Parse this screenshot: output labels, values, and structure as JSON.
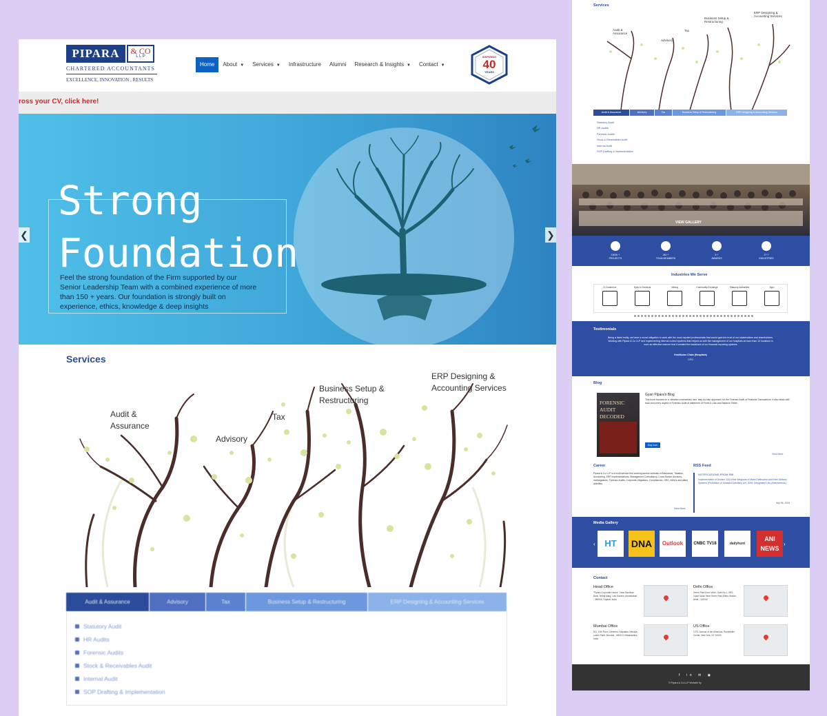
{
  "logo": {
    "name": "PIPARA",
    "co": "& CO",
    "llp": "L L P",
    "subtitle": "CHARTERED ACCOUNTANTS",
    "tagline": "EXCELLENCE, INNOVATION , RESULTS"
  },
  "nav": {
    "items": [
      {
        "label": "Home",
        "active": true,
        "dropdown": false
      },
      {
        "label": "About",
        "dropdown": true
      },
      {
        "label": "Services",
        "dropdown": true
      },
      {
        "label": "Infrastructure",
        "dropdown": false
      },
      {
        "label": "Alumni",
        "dropdown": false
      },
      {
        "label": "Research & Insights",
        "dropdown": true
      },
      {
        "label": "Contact",
        "dropdown": true
      }
    ]
  },
  "badge": {
    "top": "INSPIRING",
    "number": "40",
    "bottom": "YEARS"
  },
  "ticker": {
    "text": "ross your CV, click here!"
  },
  "hero": {
    "title": "Strong\nFoundation",
    "text": "Feel the strong foundation of the Firm supported by our Senior Leadership Team with a combined experience of more than 150 + years. Our foundation is strongly built on experience, ethics, knowledge & deep insights"
  },
  "services": {
    "heading": "Services",
    "tree_labels": [
      "Audit &\nAssurance",
      "Advisory",
      "Tax",
      "Business Setup &\nRestructuring",
      "ERP Designing &\nAccounting Services"
    ],
    "tabs": [
      "Audit & Assurance",
      "Advisory",
      "Tax",
      "Business Setup & Restructuring",
      "ERP Designing & Accounting Services"
    ],
    "list": [
      "Statutory Audit",
      "HR Audits",
      "Forensic Audits",
      "Stock & Receivables Audit",
      "Internal Audit",
      "SOP Drafting & Implementation"
    ]
  },
  "right": {
    "services_heading": "Services",
    "gallery_label": "VIEW GALLERY",
    "stats": [
      {
        "value": "15000 +",
        "label": "PROJECTS"
      },
      {
        "value": "240 +",
        "label": "TEAM MEMBERS"
      },
      {
        "value": "9 +",
        "label": "AWARDS"
      },
      {
        "value": "27 +",
        "label": "INDUSTRIES"
      }
    ],
    "industries_heading": "Industries We Serve",
    "industries": [
      "E-Commerce",
      "Dyes & Chemical",
      "Mining",
      "Commodity Exchange",
      "Statutory Authorities",
      "Agro"
    ],
    "testimonials_heading": "Testimonials",
    "testimonial_text": "Being a listed entity, we have a moral obligation to work with the most reputed professionals that would gain the trust of our stakeholders and shareholders. Working with Pipara & Co LLP and implementing internal control systems that helped us with the management of our hospitals at more than 10 locations in such an effective manner that it created the backbone of our financial reporting systems",
    "testimonial_author": "Healthcare Chain (Hospitals)",
    "testimonial_role": "CFO",
    "blog_heading": "Blog",
    "book_title": "FORENSIC\nAUDIT\nDECODED",
    "blog_title": "Gyan Pipara's Blog",
    "blog_text": "This book focuses on a 'detailed commentary' and 'step-by-step approach' for the Forensic Audit of Financial Transactions. It also deals with each and every aspect of Forensic Audit of statement of Profit & Loss and Balance Sheet.",
    "buy_label": "Buy now",
    "view_more": "View More",
    "career_heading": "Career",
    "career_text": "Pipara & Co LLP is a multi-service firm working across verticals of Assurance, Taxation, Accounting, ERP Implementations, Management Consultancy, Cross Border Advisory, Investigations, Forensic Audits, Corporate Litigations, Compliances, GRC, M&A's and allied activities.",
    "rss_heading": "RSS Feed",
    "rss_title": "NOTIFICATIONS FROM RBI",
    "rss_text": "Implementation of Section 12A of the Weapons of Mass Destruction and their Delivery Systems (Prohibition of Unlawful Activities) Act, 2005: Designated List (Amendments)",
    "rss_date": "July 06, 2024",
    "media_heading": "Media Gallery",
    "media": [
      "HT",
      "DNA",
      "Outlook",
      "CNBC TV18",
      "dailyhunt",
      "ANI NEWS"
    ],
    "contact_heading": "Contact",
    "offices": [
      {
        "name": "Head Office",
        "text": "\"Pipara Corporate House\", Near Bandhan Bank, Netaji Marg, Law Garden, Ahmedabad - 380006, Gujarat, India"
      },
      {
        "name": "Delhi Office",
        "text": "Green Park Doux Work, Gate No.1, 4R/1, Yusuf Sarai, Near Green Park Metro Station, Delhi - 110016"
      },
      {
        "name": "Mumbai Office",
        "text": "811, 11th Floor, Cerebrus, Kalpataru Lifestyle, Lower Parel, Mumbai - 400013, Maharashtra, India"
      },
      {
        "name": "US Office",
        "text": "1270, Avenue of the Americas, Rockefeller Center, New York, NY 10020"
      }
    ],
    "footer_text": "© Pipara & Co LLP Website by"
  },
  "colors": {
    "brand": "#1c3f8a",
    "nav_active": "#0d61c4",
    "accent_red": "#e02020",
    "panel_blue": "#2d4ea2"
  }
}
